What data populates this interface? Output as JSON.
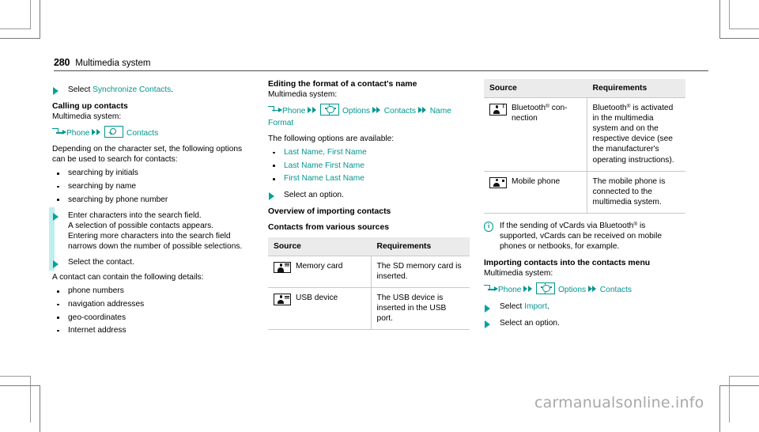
{
  "header": {
    "page_number": "280",
    "title": "Multimedia system"
  },
  "watermark": "carmanualsonline.info",
  "colors": {
    "accent_teal": "#00968f",
    "marker_teal": "#00a39b",
    "change_bar": "#bfeeee",
    "table_header_bg": "#ebebeb",
    "table_rule": "#c9c9c9"
  },
  "column1": {
    "step_select_sync": {
      "prefix": "Select ",
      "link": "Synchronize Contacts",
      "suffix": "."
    },
    "heading_calling_up": "Calling up contacts",
    "system_label": "Multimedia system:",
    "menu_path": {
      "enter_icon": "enter-arrow-icon",
      "item1": "Phone",
      "chevron_icon": "double-chevron-icon",
      "search_icon": "search-box-icon",
      "item2": "Contacts"
    },
    "para_depending": "Depending on the character set, the following options can be used to search for contacts:",
    "search_options": [
      "searching by initials",
      "searching by name",
      "searching by phone number"
    ],
    "step_enter_chars": "Enter characters into the search field.\nA selection of possible contacts appears.\nEntering more characters into the search field narrows down the number of possible selections.",
    "step_select_contact": "Select the contact.",
    "para_contact_details": "A contact can contain the following details:",
    "contact_details": [
      "phone numbers",
      "navigation addresses",
      "geo-coordinates",
      "Internet address"
    ]
  },
  "column2": {
    "heading_editing_format": "Editing the format of a contact's name",
    "system_label": "Multimedia system:",
    "menu_path": {
      "enter_icon": "enter-arrow-icon",
      "item1": "Phone",
      "chevron_icon": "double-chevron-icon",
      "gear_icon": "options-gear-box-icon",
      "item2": "Options",
      "item3": "Contacts",
      "item4": "Name Format"
    },
    "para_following_options": "The following options are available:",
    "name_format_options": [
      "Last Name, First Name",
      "Last Name First Name",
      "First Name Last Name"
    ],
    "step_select_option": "Select an option.",
    "heading_overview": "Overview of importing contacts",
    "heading_contacts_sources": "Contacts from various sources",
    "table": {
      "columns": [
        "Source",
        "Requirements"
      ],
      "rows": [
        {
          "icon": "contact-card-icon",
          "source": "Memory card",
          "requirements": "The SD memory card is inserted."
        },
        {
          "icon": "contact-card-icon",
          "source": "USB device",
          "requirements": "The USB device is inserted in the USB port."
        }
      ]
    }
  },
  "column3": {
    "table": {
      "columns": [
        "Source",
        "Requirements"
      ],
      "rows": [
        {
          "icon": "contact-card-bluetooth-icon",
          "source_pre": "Bluetooth",
          "source_sup": "®",
          "source_post": " con-nection",
          "req_pre": "Bluetooth",
          "req_sup": "®",
          "req_post": " is activated in the multimedia system and on the respective device (see the manufacturer's operating instructions)."
        },
        {
          "icon": "contact-card-mobile-icon",
          "source_pre": "Mobile phone",
          "source_sup": "",
          "source_post": "",
          "req_pre": "The mobile phone is connected to the multimedia system.",
          "req_sup": "",
          "req_post": ""
        }
      ]
    },
    "note": {
      "icon": "info-circle-icon",
      "text_pre": "If the sending of vCards via Bluetooth",
      "text_sup": "®",
      "text_post": " is supported, vCards can be received on mobile phones or netbooks, for example."
    },
    "heading_importing": "Importing contacts into the contacts menu",
    "system_label": "Multimedia system:",
    "menu_path": {
      "enter_icon": "enter-arrow-icon",
      "item1": "Phone",
      "chevron_icon": "double-chevron-icon",
      "gear_icon": "options-gear-box-icon",
      "item2": "Options",
      "item3": "Contacts"
    },
    "step_select_import": {
      "prefix": "Select ",
      "link": "Import",
      "suffix": "."
    },
    "step_select_option": "Select an option."
  }
}
